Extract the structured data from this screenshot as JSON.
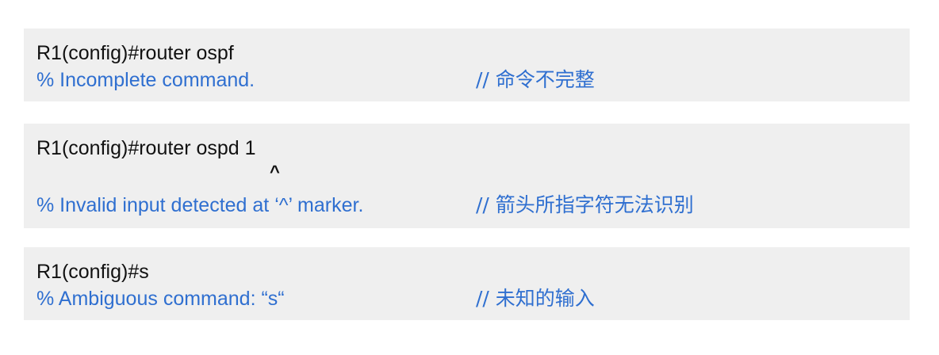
{
  "blocks": [
    {
      "command": "R1(config)#router ospf",
      "message": "% Incomplete command.",
      "comment": "// 命令不完整"
    },
    {
      "command": "R1(config)#router ospd 1",
      "caret": "^",
      "message": "% Invalid input detected at ‘^’ marker.",
      "comment": "// 箭头所指字符无法识别"
    },
    {
      "command": "R1(config)#s",
      "message": "% Ambiguous command:  “s“",
      "comment": "// 未知的输入"
    }
  ],
  "colors": {
    "command_text": "#111111",
    "message_text": "#2f6fd0",
    "block_background": "#efefef"
  }
}
